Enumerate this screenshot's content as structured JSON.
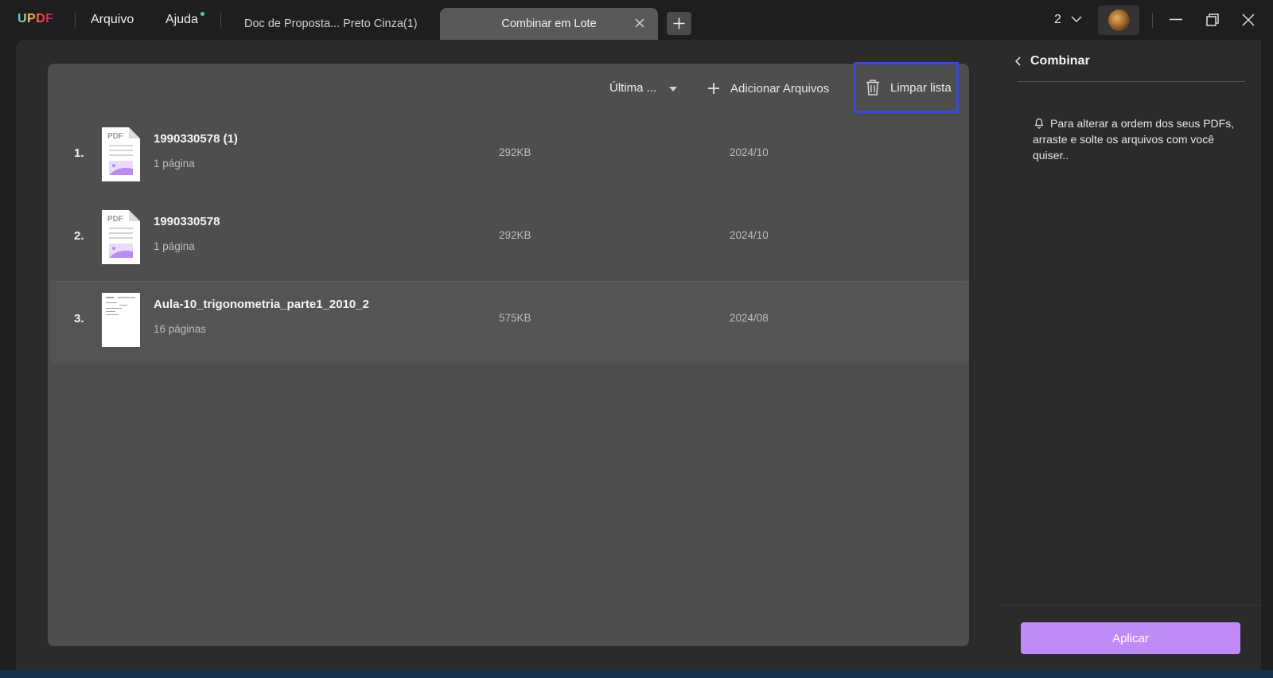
{
  "titlebar": {
    "logo": "UPDF",
    "menu": [
      "Arquivo",
      "Ajuda"
    ],
    "tabs": [
      {
        "label": "Doc de Proposta... Preto Cinza(1)"
      },
      {
        "label": "Combinar em Lote"
      }
    ],
    "window_count": "2"
  },
  "toolbar": {
    "sort_label": "Última ...",
    "add_files_label": "Adicionar Arquivos",
    "clear_list_label": "Limpar lista"
  },
  "files": [
    {
      "num": "1.",
      "name": "1990330578 (1)",
      "pages": "1 página",
      "size": "292KB",
      "date": "2024/10",
      "thumb": "PDF"
    },
    {
      "num": "2.",
      "name": "1990330578",
      "pages": "1 página",
      "size": "292KB",
      "date": "2024/10",
      "thumb": "PDF"
    },
    {
      "num": "3.",
      "name": "Aula-10_trigonometria_parte1_2010_2",
      "pages": "16 páginas",
      "size": "575KB",
      "date": "2024/08"
    }
  ],
  "right_panel": {
    "title": "Combinar",
    "hint": "Para alterar a ordem dos seus PDFs, arraste e solte os arquivos com você quiser..",
    "apply_label": "Aplicar"
  },
  "colors": {
    "accent": "#c08bf7",
    "highlight_border": "#3a4bd8",
    "status_dot": "#4fd1a5"
  }
}
